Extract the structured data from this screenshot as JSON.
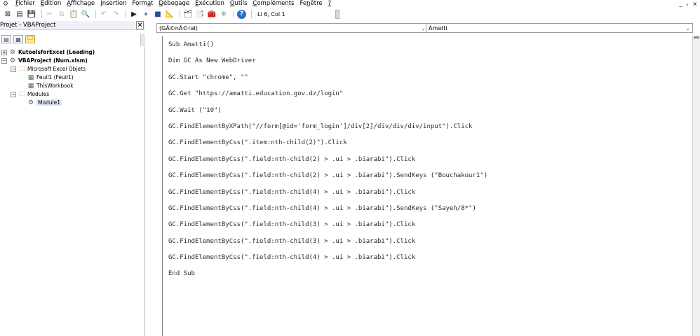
{
  "menu": {
    "items": [
      {
        "pre": "",
        "ul": "F",
        "post": "ichier"
      },
      {
        "pre": "",
        "ul": "E",
        "post": "dition"
      },
      {
        "pre": "",
        "ul": "A",
        "post": "ffichage"
      },
      {
        "pre": "",
        "ul": "I",
        "post": "nsertion"
      },
      {
        "pre": "Form",
        "ul": "a",
        "post": "t"
      },
      {
        "pre": "",
        "ul": "D",
        "post": "ébogage"
      },
      {
        "pre": "",
        "ul": "E",
        "post": "xécution"
      },
      {
        "pre": "",
        "ul": "O",
        "post": "utils"
      },
      {
        "pre": "",
        "ul": "C",
        "post": "ompléments"
      },
      {
        "pre": "Fe",
        "ul": "n",
        "post": "être"
      },
      {
        "pre": "",
        "ul": "?",
        "post": ""
      }
    ],
    "window_controls": [
      "_",
      "ₛ",
      "×"
    ]
  },
  "toolbar": {
    "cursor_position": "Li 6, Col 1"
  },
  "project": {
    "title": "Projet - VBAProject",
    "close_label": "✕",
    "tree": [
      {
        "label": "KutoolsforExcel (Loading)",
        "expander": "+",
        "icon": "vba-project-icon",
        "glyph": "⚙",
        "bold": true
      },
      {
        "label": "VBAProject (Num.xlsm)",
        "expander": "−",
        "icon": "vba-project-icon",
        "glyph": "⚙",
        "bold": true
      },
      {
        "label": "Microsoft Excel Objets",
        "expander": "−",
        "icon": "folder-icon",
        "glyph": "🗀",
        "bold": false
      },
      {
        "label": "Feuil1 (Feuil1)",
        "expander": "",
        "icon": "worksheet-icon",
        "glyph": "▦",
        "bold": false
      },
      {
        "label": "ThisWorkbook",
        "expander": "",
        "icon": "workbook-icon",
        "glyph": "▦",
        "bold": false
      },
      {
        "label": "Modules",
        "expander": "−",
        "icon": "folder-icon",
        "glyph": "🗀",
        "bold": false
      },
      {
        "label": "Module1",
        "expander": "",
        "icon": "module-icon",
        "glyph": "⚙",
        "bold": false
      }
    ]
  },
  "code_pane": {
    "object_combo": "(GÃ©nÃ©ral)",
    "procedure_combo": "Amatti",
    "lines": [
      "Sub Amatti()",
      "Dim GC As New WebDriver",
      "GC.Start \"chrome\", \"\"",
      "GC.Get \"https://amatti.education.gov.dz/login\"",
      "GC.Wait (\"10\")",
      "GC.FindElementByXPath(\"//form[@id='form_login']/div[2]/div/div/div/input\").Click",
      "GC.FindElementByCss(\".item:nth-child(2)\").Click",
      "GC.FindElementByCss(\".field:nth-child(2) > .ui > .biarabi\").Click",
      "GC.FindElementByCss(\".field:nth-child(2) > .ui > .biarabi\").SendKeys (\"Bouchakour1\")",
      "GC.FindElementByCss(\".field:nth-child(4) > .ui > .biarabi\").Click",
      "GC.FindElementByCss(\".field:nth-child(4) > .ui > .biarabi\").SendKeys (\"Sayeh/8*\")",
      "GC.FindElementByCss(\".field:nth-child(3) > .ui > .biarabi\").Click",
      "GC.FindElementByCss(\".field:nth-child(3) > .ui > .biarabi\").Click",
      "GC.FindElementByCss(\".field:nth-child(4) > .ui > .biarabi\").Click",
      "End Sub"
    ]
  }
}
